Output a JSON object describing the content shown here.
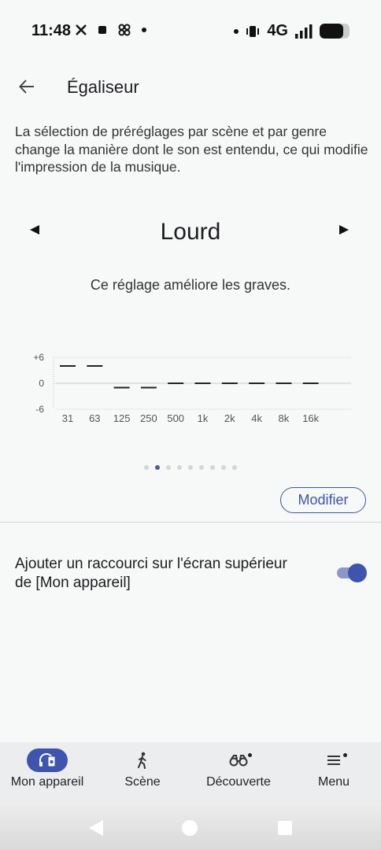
{
  "status_bar": {
    "time": "11:48",
    "network": "4G",
    "battery_level": 0.8,
    "left_icons": [
      "x-logo-icon",
      "square-icon",
      "pinwheel-icon",
      "dot-icon"
    ],
    "right_icons": [
      "dot-icon",
      "vibrate-icon",
      "signal-icon",
      "battery-icon"
    ]
  },
  "header": {
    "title": "Égaliseur",
    "back_icon": "arrow-left-icon"
  },
  "description": "La sélection de préréglages par scène et par genre change la manière dont le son est entendu, ce qui modifie l'impression de la musique.",
  "preset": {
    "name": "Lourd",
    "description": "Ce réglage améliore les graves.",
    "prev_icon": "triangle-left-icon",
    "next_icon": "triangle-right-icon"
  },
  "chart_data": {
    "type": "bar",
    "categories": [
      "31",
      "63",
      "125",
      "250",
      "500",
      "1k",
      "2k",
      "4k",
      "8k",
      "16k"
    ],
    "values": [
      4,
      4,
      -1,
      -1,
      0,
      0,
      0,
      0,
      0,
      0
    ],
    "ylim": [
      -6,
      6
    ],
    "ytick_labels": [
      "+6",
      "0",
      "-6"
    ],
    "grid": false
  },
  "pager": {
    "count": 9,
    "active_index": 1
  },
  "modify_button": {
    "label": "Modifier"
  },
  "shortcut": {
    "label": "Ajouter un raccourci sur l'écran supérieur de [Mon appareil]",
    "enabled": true
  },
  "bottom_nav": {
    "items": [
      {
        "label": "Mon appareil",
        "icon": "headphones-device-icon",
        "active": true,
        "badge": false
      },
      {
        "label": "Scène",
        "icon": "walking-person-icon",
        "active": false,
        "badge": false
      },
      {
        "label": "Découverte",
        "icon": "binoculars-icon",
        "active": false,
        "badge": true
      },
      {
        "label": "Menu",
        "icon": "hamburger-menu-icon",
        "active": false,
        "badge": true
      }
    ]
  },
  "system_nav": {
    "icons": [
      "back-triangle-icon",
      "home-circle-icon",
      "recents-square-icon"
    ]
  },
  "colors": {
    "accent": "#3f55ad",
    "background": "#f7f8f8",
    "text": "#1d1d1f"
  }
}
